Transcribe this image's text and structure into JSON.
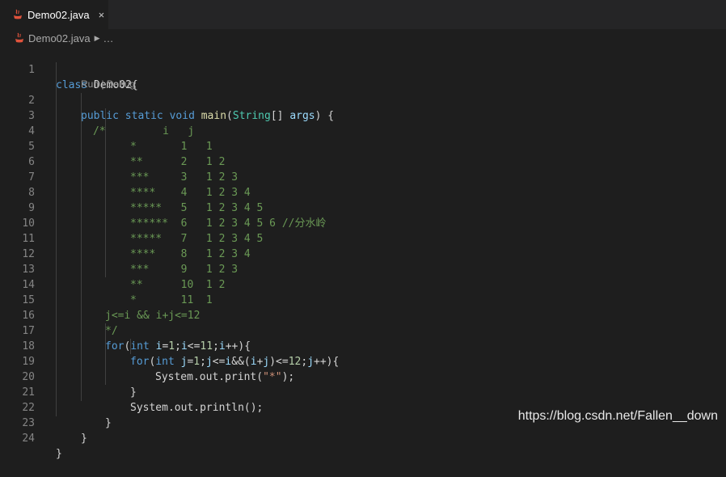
{
  "tab": {
    "label": "Demo02.java",
    "close": "×",
    "icon": "java-coffee-icon"
  },
  "breadcrumb": {
    "file": "Demo02.java",
    "sep": "›",
    "more": "…"
  },
  "codelens": {
    "run": "Run",
    "divider": " | ",
    "debug": "Debug"
  },
  "code": {
    "l1": [
      "class",
      " Demo02{"
    ],
    "l2": [
      "public",
      " ",
      "static",
      " ",
      "void",
      " ",
      "main",
      "(",
      "String",
      "[] ",
      "args",
      ") {"
    ],
    "l3": "/*         i   j",
    "l4": "*       1   1",
    "l5": "**      2   1 2",
    "l6": "***     3   1 2 3",
    "l7": "****    4   1 2 3 4",
    "l8": "*****   5   1 2 3 4 5",
    "l9": "******  6   1 2 3 4 5 6 //分水岭",
    "l10": "*****   7   1 2 3 4 5",
    "l11": "****    8   1 2 3 4",
    "l12": "***     9   1 2 3",
    "l13": "**      10  1 2",
    "l14": "*       11  1",
    "l15": "j<=i && i+j<=12",
    "l16": "*/",
    "l17": [
      "for",
      "(",
      "int",
      " ",
      "i",
      "=",
      "1",
      ";",
      "i",
      "<=",
      "11",
      ";",
      "i",
      "++){"
    ],
    "l18": [
      "for",
      "(",
      "int",
      " ",
      "j",
      "=",
      "1",
      ";",
      "j",
      "<=",
      "i",
      "&&(",
      "i",
      "+",
      "j",
      ")<=",
      "12",
      ";",
      "j",
      "++){"
    ],
    "l19": [
      "System",
      ".",
      "out",
      ".",
      "print",
      "(",
      "\"*\"",
      ");"
    ],
    "l20": "}",
    "l21": [
      "System",
      ".",
      "out",
      ".",
      "println",
      "();"
    ],
    "l22": "}",
    "l23": "}",
    "l24": "}"
  },
  "line_numbers": [
    "1",
    "2",
    "3",
    "4",
    "5",
    "6",
    "7",
    "8",
    "9",
    "10",
    "11",
    "12",
    "13",
    "14",
    "15",
    "16",
    "17",
    "18",
    "19",
    "20",
    "21",
    "22",
    "23",
    "24"
  ],
  "watermark": "https://blog.csdn.net/Fallen__down",
  "colors": {
    "background": "#1e1e1e",
    "keyword": "#569cd6",
    "type": "#4ec9b0",
    "function": "#dcdcaa",
    "comment": "#6a9955",
    "string": "#ce9178",
    "number": "#b5cea8",
    "variable": "#9cdcfe"
  }
}
